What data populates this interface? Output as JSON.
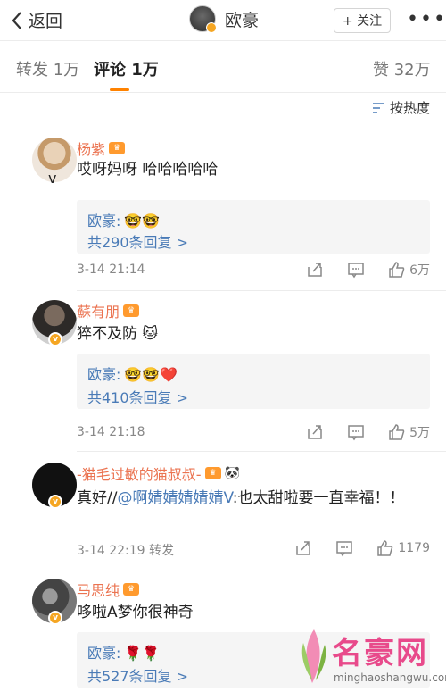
{
  "nav": {
    "back_label": "返回",
    "title": "欧豪",
    "follow_label": "+ 关注",
    "more_label": "•••"
  },
  "tabs": {
    "repost": "转发 1万",
    "comments": "评论 1万",
    "likes": "赞 32万"
  },
  "sort_label": "按热度",
  "comments": [
    {
      "name": "杨紫",
      "text": "哎呀妈呀 哈哈哈哈哈",
      "reply_author": "欧豪:",
      "reply_emoji": "🤓🤓",
      "reply_count": "共290条回复 >",
      "time": "3-14  21:14",
      "likes": "6万"
    },
    {
      "name": "蘇有朋",
      "text": "猝不及防 🐱",
      "reply_author": "欧豪:",
      "reply_emoji": "🤓🤓❤️",
      "reply_count": "共410条回复 >",
      "time": "3-14  21:18",
      "likes": "5万"
    },
    {
      "name": "-猫毛过敏的猫叔叔-",
      "text_prefix": "真好//",
      "text_at": "@啊婧婧婧婧婧V",
      "text_suffix": ":也太甜啦要一直幸福！！",
      "time": "3-14  22:19  转发",
      "likes": "1179"
    },
    {
      "name": "马思纯",
      "text": "哆啦A梦你很神奇",
      "reply_author": "欧豪:",
      "reply_emoji": "🌹🌹",
      "reply_count": "共527条回复 >"
    }
  ],
  "watermark": {
    "brand": "名豪网",
    "url": "minghaoshangwu.com"
  }
}
